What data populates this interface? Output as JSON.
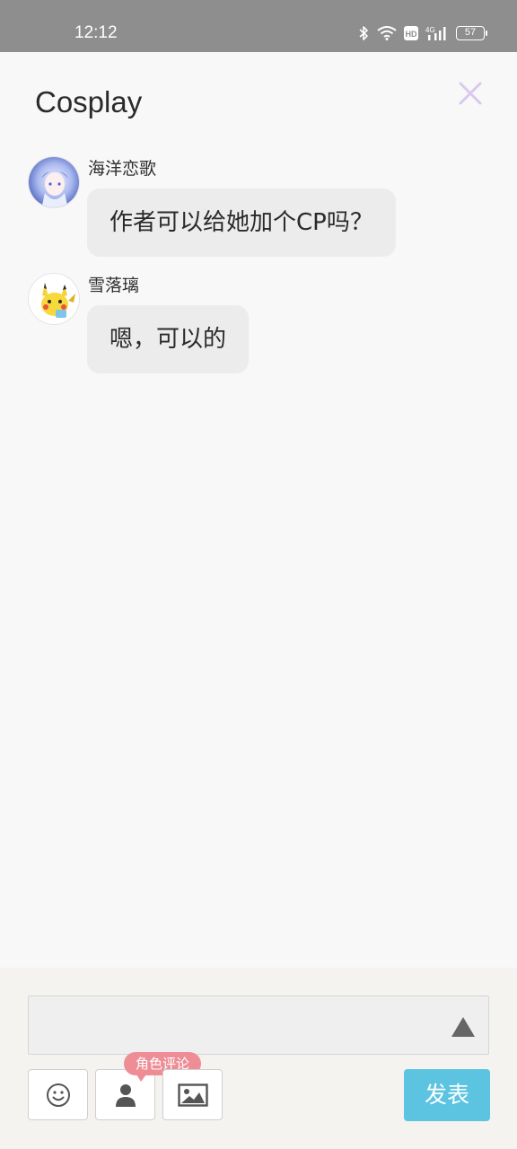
{
  "status_bar": {
    "time": "12:12",
    "network_badge": "HD",
    "network_type": "4G",
    "battery": "57",
    "icons": [
      "bluetooth-icon",
      "wifi-icon",
      "hd-icon",
      "signal-icon",
      "battery-icon"
    ]
  },
  "header": {
    "title": "Cosplay",
    "close_icon": "close-icon",
    "close_color": "#d9c8ef"
  },
  "messages": [
    {
      "username": "海洋恋歌",
      "text": "作者可以给她加个CP吗？",
      "avatar": "anime-girl-avatar"
    },
    {
      "username": "雪落璃",
      "text": "嗯，可以的",
      "avatar": "pikachu-avatar"
    }
  ],
  "composer": {
    "input_value": "",
    "input_placeholder": "",
    "expand_icon": "triangle-up-icon",
    "tools": [
      {
        "name": "emoji-icon"
      },
      {
        "name": "person-icon",
        "badge": "角色评论"
      },
      {
        "name": "image-icon"
      }
    ],
    "submit_label": "发表",
    "submit_color": "#5cc4e0",
    "badge_color": "#ef8d96"
  }
}
